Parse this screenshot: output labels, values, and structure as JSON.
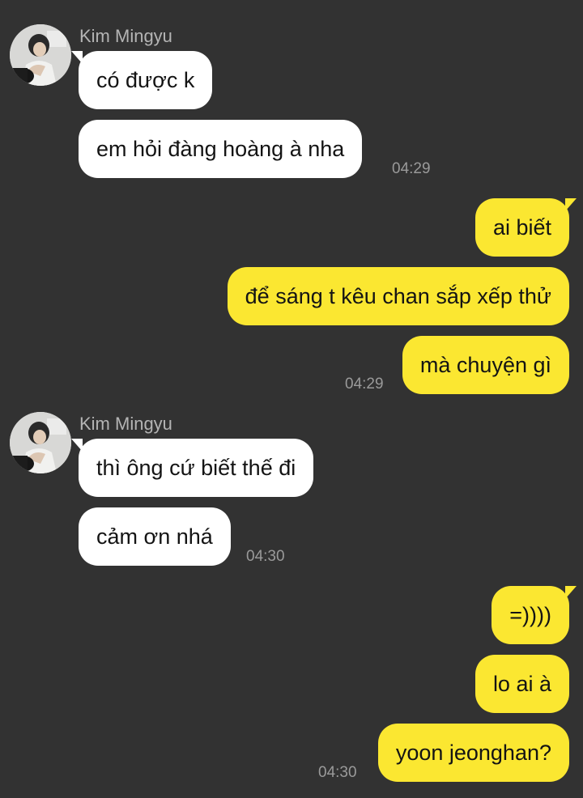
{
  "chat": {
    "groups": [
      {
        "sender": "Kim Mingyu",
        "messages": [
          "có được k",
          "em hỏi đàng hoàng à nha"
        ],
        "time": "04:29"
      },
      {
        "messages": [
          "ai biết",
          "để sáng t kêu chan sắp xếp thử",
          "mà chuyện gì"
        ],
        "time": "04:29"
      },
      {
        "sender": "Kim Mingyu",
        "messages": [
          "thì ông cứ biết thế đi",
          "cảm ơn nhá"
        ],
        "time": "04:30"
      },
      {
        "messages": [
          "=))))",
          "lo ai à",
          "yoon jeonghan?"
        ],
        "time": "04:30"
      }
    ]
  },
  "colors": {
    "background": "#323232",
    "incoming_bubble": "#ffffff",
    "outgoing_bubble": "#fbe731",
    "sender_text": "#b4b4b4",
    "timestamp_text": "#9a9a9a"
  },
  "icons": {
    "avatar": "profile-photo"
  }
}
